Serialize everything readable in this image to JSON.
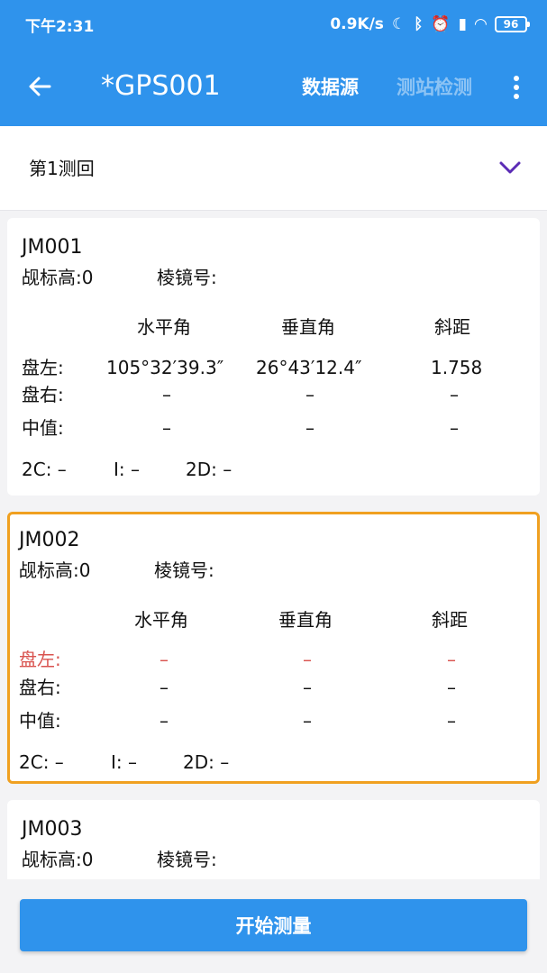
{
  "status_bar": {
    "time": "下午2:31",
    "speed": "0.9K/s",
    "battery": "96"
  },
  "app_bar": {
    "title": "*GPS001",
    "menu_source": "数据源",
    "menu_check": "测站检测"
  },
  "round": {
    "label": "第1测回"
  },
  "labels": {
    "prism_height": "觇标高:0",
    "prism_no": "棱镜号:",
    "col_h": "水平角",
    "col_v": "垂直角",
    "col_d": "斜距",
    "row_left": "盘左:",
    "row_right": "盘右:",
    "row_mid": "中值:",
    "c2": "2C: –",
    "i": "I: –",
    "d2": "2D: –",
    "dash": "–"
  },
  "points": [
    {
      "name": "JM001",
      "left_h": "105°32′39.3″",
      "left_v": "26°43′12.4″",
      "left_d": "1.758"
    },
    {
      "name": "JM002"
    },
    {
      "name": "JM003"
    }
  ],
  "button": {
    "start": "开始测量"
  }
}
